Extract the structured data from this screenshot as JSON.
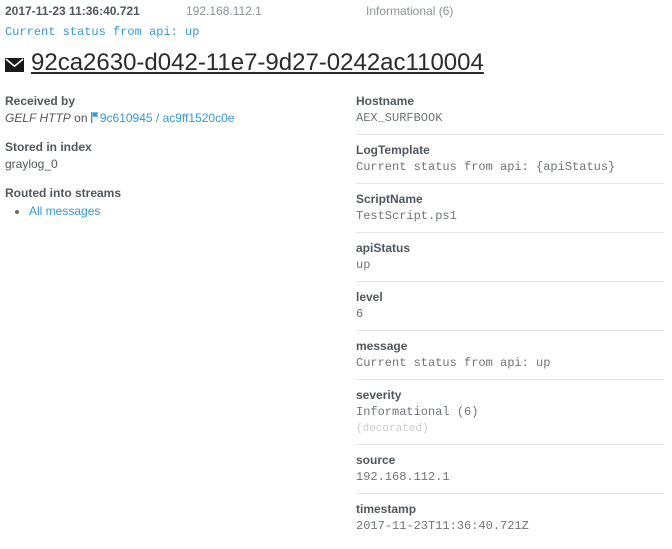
{
  "summary": {
    "timestamp": "2017-11-23 11:36:40.721",
    "source": "192.168.112.1",
    "level": "Informational (6)"
  },
  "message_preview": "Current status from api: up",
  "message_id": {
    "icon": "envelope-icon",
    "value": "92ca2630-d042-11e7-9d27-0242ac110004"
  },
  "left": {
    "received_by": {
      "title": "Received by",
      "input": "GELF HTTP",
      "on_word": "on",
      "node_icon": "node-icon",
      "node_id": "9c610945",
      "separator": "/",
      "node_name": "ac9ff1520c0e"
    },
    "stored_in_index": {
      "title": "Stored in index",
      "value": "graylog_0"
    },
    "routed_into_streams": {
      "title": "Routed into streams",
      "streams": [
        "All messages"
      ]
    }
  },
  "fields": [
    {
      "key": "Hostname",
      "value": "AEX_SURFBOOK"
    },
    {
      "key": "LogTemplate",
      "value": "Current status from api: {apiStatus}"
    },
    {
      "key": "ScriptName",
      "value": "TestScript.ps1"
    },
    {
      "key": "apiStatus",
      "value": "up"
    },
    {
      "key": "level",
      "value": "6"
    },
    {
      "key": "message",
      "value": "Current status from api: up"
    },
    {
      "key": "severity",
      "value": "Informational (6)",
      "note": "(decorated)"
    },
    {
      "key": "source",
      "value": "192.168.112.1"
    },
    {
      "key": "timestamp",
      "value": "2017-11-23T11:36:40.721Z"
    }
  ],
  "colors": {
    "link": "#3598dc",
    "heading": "#52575c",
    "muted": "#8d9296",
    "divider": "#e6e6e6",
    "decorated": "#c7cacd"
  }
}
